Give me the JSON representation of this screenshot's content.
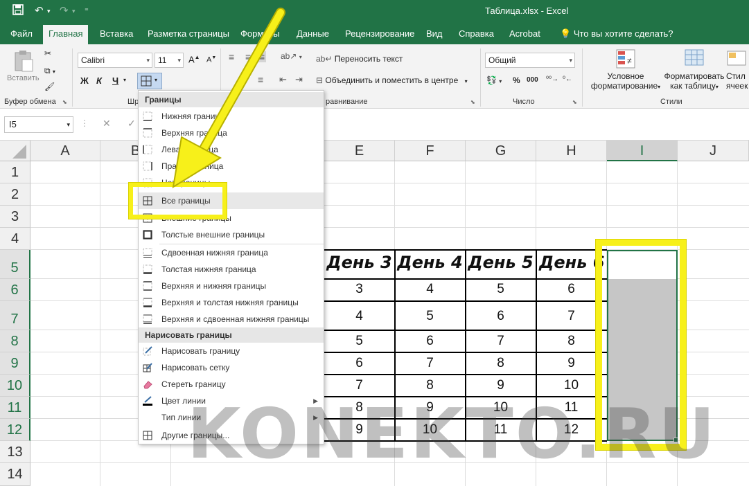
{
  "window": {
    "title": "Таблица.xlsx  -  Excel"
  },
  "tabs": [
    {
      "label": "Файл"
    },
    {
      "label": "Главная"
    },
    {
      "label": "Вставка"
    },
    {
      "label": "Разметка страницы"
    },
    {
      "label": "Формулы"
    },
    {
      "label": "Данные"
    },
    {
      "label": "Рецензирование"
    },
    {
      "label": "Вид"
    },
    {
      "label": "Справка"
    },
    {
      "label": "Acrobat"
    },
    {
      "label": "Что вы хотите сделать?"
    }
  ],
  "ribbon": {
    "paste_label": "Вставить",
    "clipboard_label": "Буфер обмена",
    "font_name": "Calibri",
    "font_size": "11",
    "font_group_label_partial": "Шр",
    "bold": "Ж",
    "italic": "К",
    "underline": "Ч",
    "wrap_text": "Переносить текст",
    "merge_center": "Объединить и поместить в центре",
    "alignment_label_partial": "равнивание",
    "number_format": "Общий",
    "number_label": "Число",
    "percent": "%",
    "thousands": "000",
    "conditional_1": "Условное",
    "conditional_2": "форматирование",
    "format_table_1": "Форматировать",
    "format_table_2": "как таблицу",
    "cell_styles_1": "Стил",
    "cell_styles_2": "ячеек",
    "styles_label": "Стили"
  },
  "formula_bar": {
    "name_box": "I5",
    "cancel": "✕",
    "confirm": "✓"
  },
  "columns": [
    "A",
    "B",
    "E",
    "F",
    "G",
    "H",
    "I",
    "J"
  ],
  "rows": [
    "1",
    "2",
    "3",
    "4",
    "5",
    "6",
    "7",
    "8",
    "9",
    "10",
    "11",
    "12",
    "13",
    "14"
  ],
  "table": {
    "headers": [
      "День 3",
      "День 4",
      "День 5",
      "День 6"
    ],
    "rows": [
      [
        "3",
        "4",
        "5",
        "6"
      ],
      [
        "4",
        "5",
        "6",
        "7"
      ],
      [
        "5",
        "6",
        "7",
        "8"
      ],
      [
        "6",
        "7",
        "8",
        "9"
      ],
      [
        "7",
        "8",
        "9",
        "10"
      ],
      [
        "8",
        "9",
        "10",
        "11"
      ],
      [
        "9",
        "10",
        "11",
        "12"
      ]
    ]
  },
  "borders_menu": {
    "header": "Границы",
    "items": [
      {
        "label": "Нижняя граница"
      },
      {
        "label": "Верхняя граница"
      },
      {
        "label": "Левая граница"
      },
      {
        "label": "Правая граница"
      },
      {
        "label": "Нет границы"
      },
      {
        "label": "Все границы"
      },
      {
        "label": "Внешние границы"
      },
      {
        "label": "Толстые внешние границы"
      },
      {
        "label": "Сдвоенная нижняя граница"
      },
      {
        "label": "Толстая нижняя граница"
      },
      {
        "label": "Верхняя и нижняя границы"
      },
      {
        "label": "Верхняя и толстая нижняя границы"
      },
      {
        "label": "Верхняя и сдвоенная нижняя границы"
      }
    ],
    "draw_header": "Нарисовать границы",
    "draw_items": [
      {
        "label": "Нарисовать границу"
      },
      {
        "label": "Нарисовать сетку"
      },
      {
        "label": "Стереть границу"
      },
      {
        "label": "Цвет линии"
      },
      {
        "label": "Тип линии"
      },
      {
        "label": "Другие границы..."
      }
    ]
  },
  "watermark": "KONEKTO.RU",
  "colors": {
    "excel_green": "#217346",
    "highlight": "#f7f01a",
    "selection": "#c6c6c6"
  }
}
